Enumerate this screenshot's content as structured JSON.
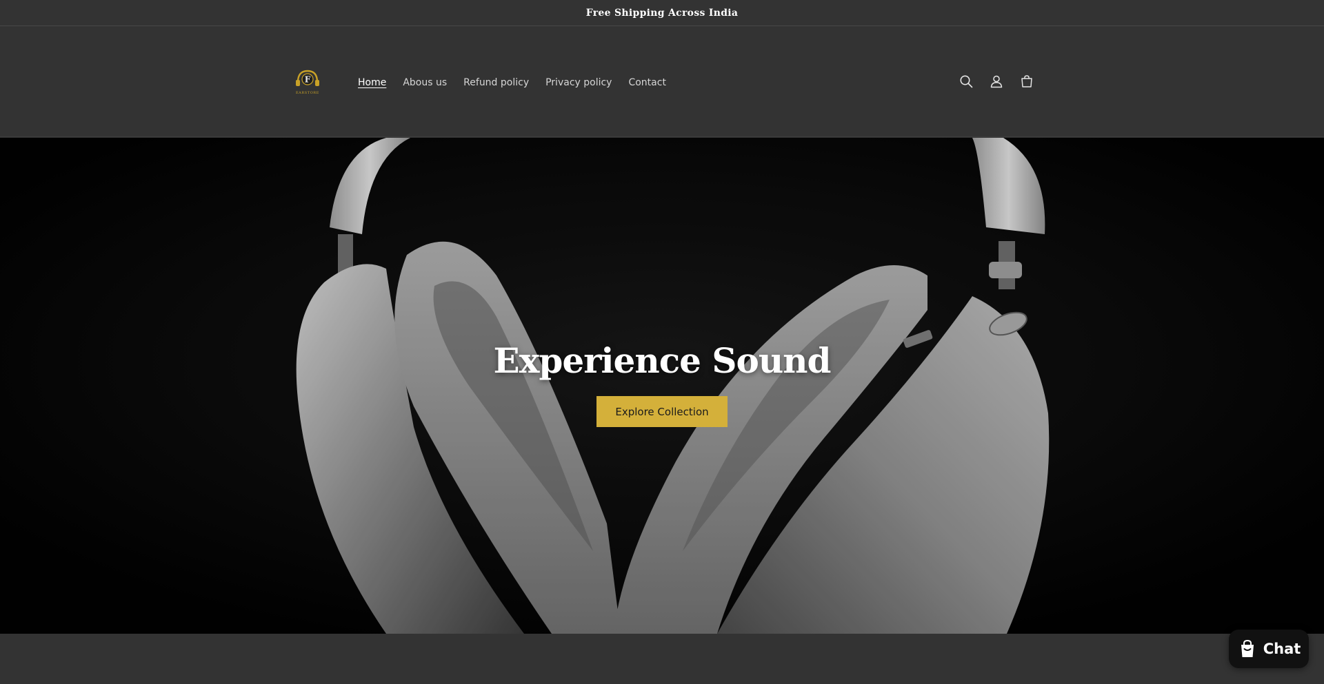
{
  "announcement": {
    "text": "Free Shipping Across India"
  },
  "header": {
    "logo": {
      "letter": "F",
      "wordmark": "EARSTORE",
      "icon": "earstore-logo-icon"
    },
    "nav": [
      {
        "label": "Home",
        "active": true
      },
      {
        "label": "Abous us",
        "active": false
      },
      {
        "label": "Refund policy",
        "active": false
      },
      {
        "label": "Privacy policy",
        "active": false
      },
      {
        "label": "Contact",
        "active": false
      }
    ],
    "icons": [
      "search-icon",
      "account-icon",
      "cart-icon"
    ]
  },
  "hero": {
    "title": "Experience Sound",
    "button_label": "Explore Collection",
    "image": "headphones-image"
  },
  "chat": {
    "label": "Chat",
    "icon": "chat-bag-icon"
  },
  "colors": {
    "background": "#333333",
    "accent": "#d4b03a",
    "hero_background": "#050505",
    "text": "#ffffff"
  }
}
